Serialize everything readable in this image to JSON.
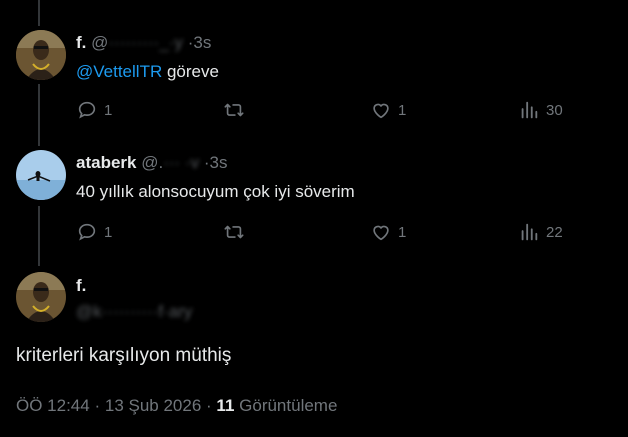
{
  "tweets": [
    {
      "name": "f.",
      "handle_visible": "@",
      "handle_obscured": "·········_·y",
      "separator": "·",
      "time": "3s",
      "mention": "@VettellTR",
      "text": " göreve",
      "replies": "1",
      "retweets": "",
      "likes": "1",
      "views": "30"
    },
    {
      "name": "ataberk",
      "handle_visible": "@.",
      "handle_obscured": "··· ·v",
      "separator": "·",
      "time": "3s",
      "text": "40 yıllık alonsocuyum çok iyi söverim",
      "replies": "1",
      "retweets": "",
      "likes": "1",
      "views": "22"
    }
  ],
  "focused": {
    "name": "f.",
    "handle_obscured": "@k··········f·ary",
    "text": "kriterleri karşılıyon müthiş",
    "time": "ÖÖ 12:44",
    "separator": "·",
    "date": "13 Şub 2026",
    "separator2": "·",
    "views_count": "11",
    "views_label": "Görüntüleme"
  },
  "icons": {
    "reply": "reply-icon",
    "retweet": "retweet-icon",
    "like": "heart-icon",
    "views": "views-bar-icon"
  },
  "colors": {
    "background": "#000000",
    "text": "#e7e9ea",
    "muted": "#71767b",
    "link": "#1d9bf0"
  }
}
